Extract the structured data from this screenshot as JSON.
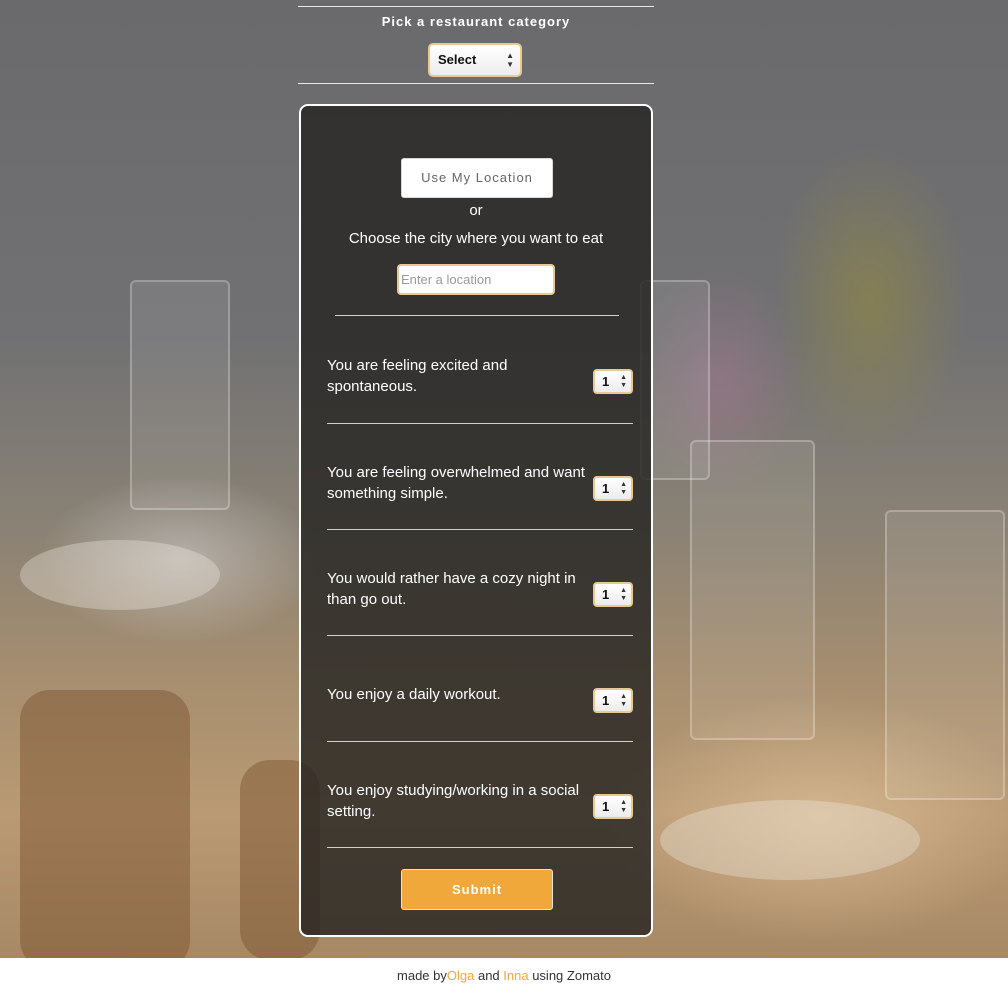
{
  "header": {
    "title": "Pick a restaurant category",
    "category_select": {
      "selected": "Select"
    }
  },
  "location": {
    "use_location_label": "Use My Location",
    "or_text": "or",
    "city_prompt": "Choose the city where you want to eat",
    "input_placeholder": "Enter a location",
    "input_value": ""
  },
  "questions": [
    {
      "text": "You are feeling excited and spontaneous.",
      "value": "1"
    },
    {
      "text": "You are feeling overwhelmed and want something simple.",
      "value": "1"
    },
    {
      "text": "You would rather have a cozy night in than go out.",
      "value": "1"
    },
    {
      "text": "You enjoy a daily workout.",
      "value": "1"
    },
    {
      "text": "You enjoy studying/working in a social setting.",
      "value": "1"
    }
  ],
  "submit_label": "Submit",
  "footer": {
    "prefix": "made by",
    "author1": "Olga",
    "and": " and ",
    "author2": "Inna",
    "suffix": " using Zomato"
  },
  "colors": {
    "accent": "#f0a83a",
    "panel": "#262422"
  }
}
